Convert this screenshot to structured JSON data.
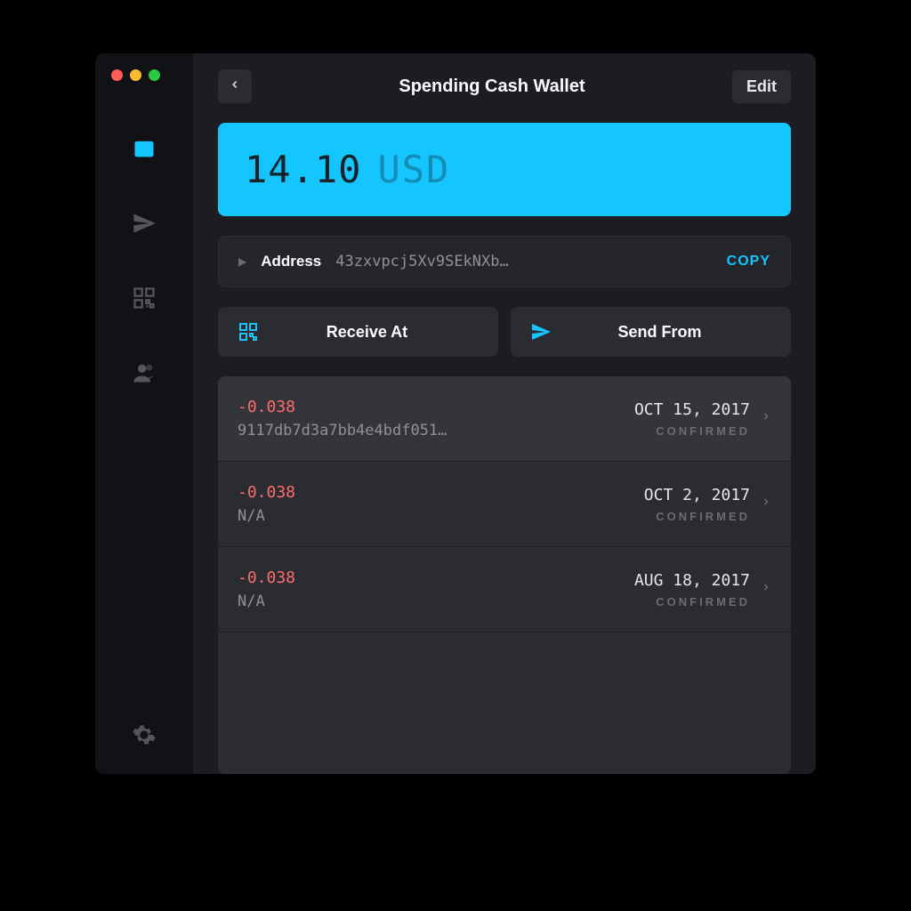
{
  "header": {
    "title": "Spending Cash Wallet",
    "edit_label": "Edit"
  },
  "balance": {
    "amount": "14.10",
    "currency": "USD"
  },
  "address": {
    "label": "Address",
    "value": "43zxvpcj5Xv9SEkNXb…",
    "copy_label": "COPY"
  },
  "actions": {
    "receive_label": "Receive At",
    "send_label": "Send From"
  },
  "transactions": [
    {
      "amount": "-0.038",
      "hash": "9117db7d3a7bb4e4bdf051…",
      "date": "OCT 15, 2017",
      "status": "CONFIRMED",
      "highlight": true
    },
    {
      "amount": "-0.038",
      "hash": "N/A",
      "date": "OCT 2, 2017",
      "status": "CONFIRMED",
      "highlight": false
    },
    {
      "amount": "-0.038",
      "hash": "N/A",
      "date": "AUG 18, 2017",
      "status": "CONFIRMED",
      "highlight": false
    }
  ],
  "sidebar": {
    "items": [
      "wallet",
      "send",
      "qr",
      "contacts"
    ],
    "active": "wallet"
  }
}
